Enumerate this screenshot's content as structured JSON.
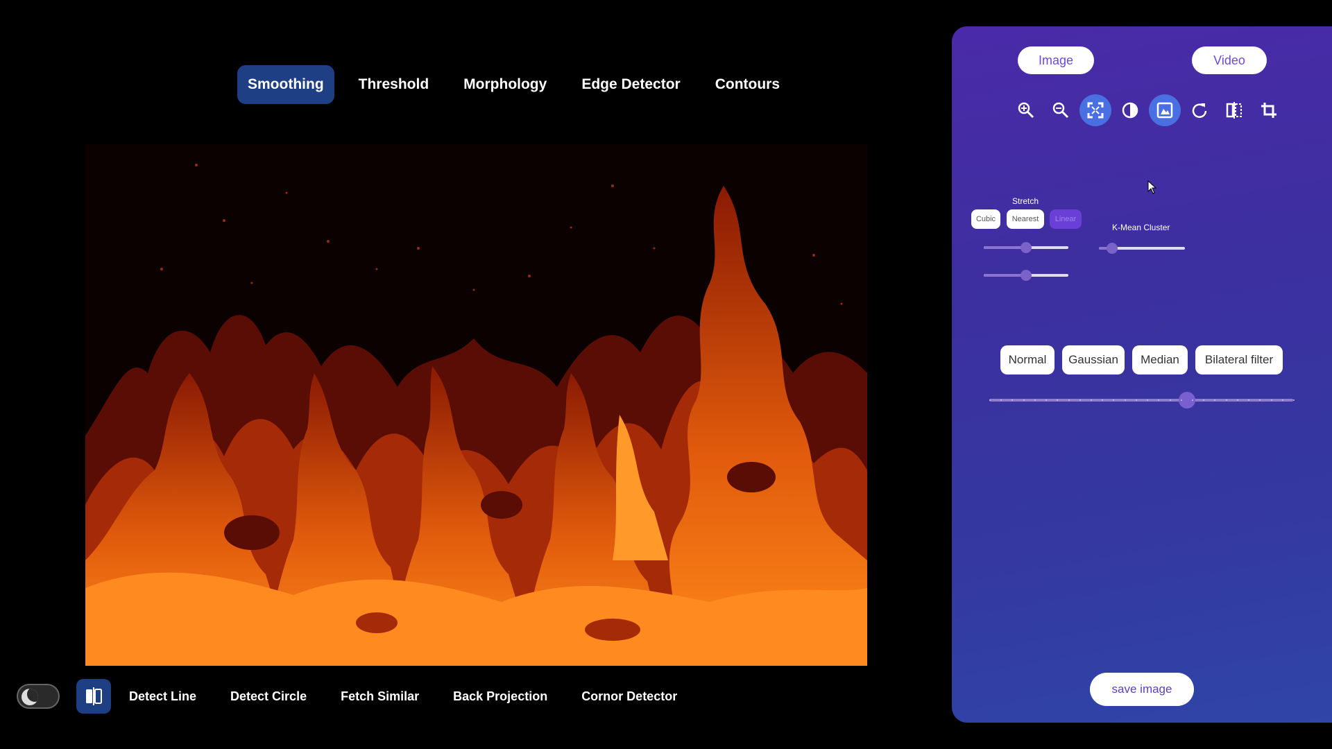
{
  "top_tabs": [
    {
      "label": "Smoothing",
      "active": true
    },
    {
      "label": "Threshold",
      "active": false
    },
    {
      "label": "Morphology",
      "active": false
    },
    {
      "label": "Edge Detector",
      "active": false
    },
    {
      "label": "Contours",
      "active": false
    }
  ],
  "bottom_tabs": [
    "Detect Line",
    "Detect Circle",
    "Fetch Similar",
    "Back Projection",
    "Cornor Detector"
  ],
  "panel": {
    "mode_buttons": {
      "image": "Image",
      "video": "Video"
    },
    "toolbar_icons": [
      "zoom-in-icon",
      "zoom-out-icon",
      "fit-screen-icon",
      "contrast-icon",
      "image-adjust-icon",
      "rotate-icon",
      "flip-icon",
      "crop-icon"
    ],
    "active_icons": [
      "fit-screen-icon",
      "image-adjust-icon"
    ],
    "stretch_label": "Stretch",
    "stretch_options": [
      {
        "label": "Cubic",
        "selected": false
      },
      {
        "label": "Nearest",
        "selected": false
      },
      {
        "label": "Linear",
        "selected": true
      }
    ],
    "stretch_slider_1": 0.5,
    "stretch_slider_2": 0.5,
    "kmean_label": "K-Mean Cluster",
    "kmean_slider": 0.15,
    "filters": [
      "Normal",
      "Gaussian",
      "Median",
      "Bilateral filter"
    ],
    "filter_slider": 0.65,
    "save_label": "save image"
  },
  "colors": {
    "accent": "#1f3f85",
    "panel_top": "#4a2aa8",
    "panel_bottom": "#3045a8",
    "toggle_on": "#4a6fe0"
  }
}
